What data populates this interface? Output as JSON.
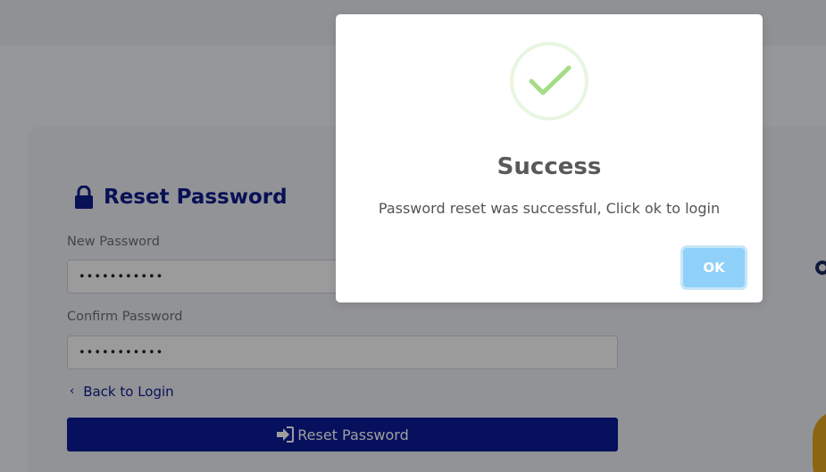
{
  "page": {
    "title": "Reset Password",
    "new_password_label": "New Password",
    "new_password_value": "•••••••••••",
    "confirm_password_label": "Confirm Password",
    "confirm_password_value": "•••••••••••",
    "back_link_chevron": "‹",
    "back_link_label": "Back to Login",
    "reset_button_label": "Reset Password",
    "icons": {
      "title_icon": "lock-icon",
      "reset_button_icon": "sign-in-icon",
      "back_icon": "chevron-left-icon"
    },
    "colors": {
      "primary": "#0a1a96",
      "title": "#0d1a8c"
    }
  },
  "modal": {
    "icon": "success-check-icon",
    "title": "Success",
    "message": "Password reset was successful, Click ok to login",
    "ok_label": "OK",
    "colors": {
      "check": "#a5dc86",
      "ok_button": "#8fd1f8"
    }
  }
}
